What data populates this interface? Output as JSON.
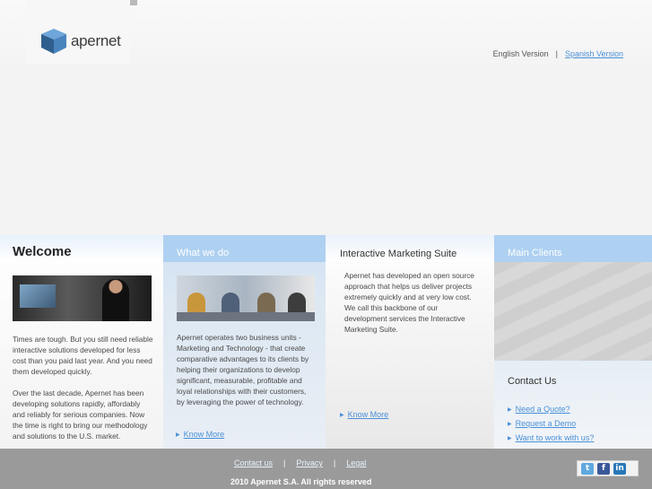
{
  "header": {
    "logo_text": "apernet",
    "lang_english": "English Version",
    "lang_sep": "|",
    "lang_spanish": "Spanish Version"
  },
  "welcome": {
    "title": "Welcome",
    "para1": "Times are tough. But you still need reliable interactive solutions developed for less cost than you paid last year. And you need them developed quickly.",
    "para2": "Over the last decade, Apernet has been developing solutions rapidly, affordably and reliably for serious companies. Now the time is right to bring our methodology and solutions to the U.S. market."
  },
  "what_we_do": {
    "title": "What we do",
    "text": "Apernet operates two business units - Marketing and Technology - that create comparative advantages to its clients by helping their organizations to develop significant, measurable, profitable and loyal relationships with their customers, by leveraging the power of technology.",
    "more": "Know More"
  },
  "ims": {
    "title": "Interactive Marketing Suite",
    "text": "Apernet has developed an open source approach that helps us deliver projects extremely quickly and at very low cost. We call this backbone of our development services the Interactive Marketing Suite.",
    "more": "Know More"
  },
  "clients": {
    "title": "Main Clients"
  },
  "contact": {
    "title": "Contact Us",
    "links": [
      "Need a Quote?",
      "Request a Demo",
      "Want to work with us?"
    ]
  },
  "footer": {
    "links": [
      "Contact us",
      "Privacy",
      "Legal"
    ],
    "sep": "|",
    "copyright": "2010 Apernet S.A. All rights reserved",
    "social": [
      "t",
      "f",
      "in"
    ]
  },
  "colors": {
    "accent": "#4a90d9",
    "header_blue": "#aed0f1",
    "footer": "#9a9a9a"
  }
}
